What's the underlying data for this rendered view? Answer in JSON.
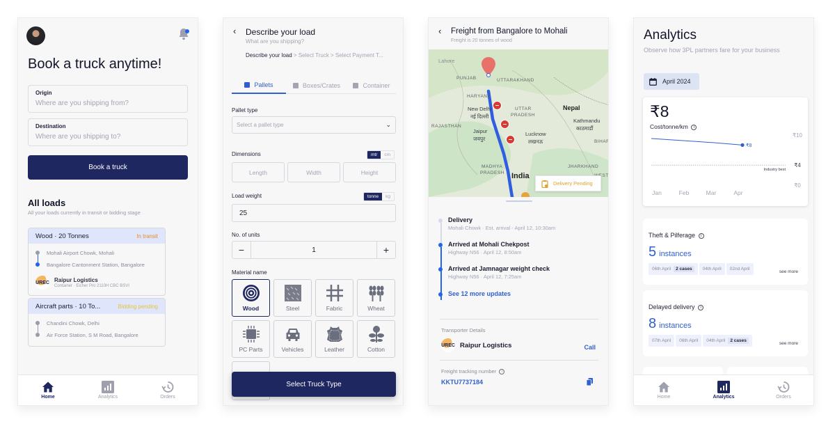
{
  "screen_home": {
    "title": "Book a truck anytime!",
    "origin": {
      "label": "Origin",
      "placeholder": "Where are you shipping from?"
    },
    "destination": {
      "label": "Destination",
      "placeholder": "Where are you shipping to?"
    },
    "book_button": "Book a truck",
    "all_loads_title": "All loads",
    "all_loads_subtitle": "All your loads currently in transit or bidding stage",
    "loads": [
      {
        "title": "Wood · 20 Tonnes",
        "status": "In transit",
        "status_color": "#e88a2e",
        "from": "Mohali Airport Chowk, Mohali",
        "to": "Bangalore Cantonment Station, Bangalore",
        "transporter": "Raipur Logistics",
        "vehicle": "Container · Eicher Pro 2110H CBC BSVI"
      },
      {
        "title": "Aircraft parts · 10 To...",
        "status": "Bidding pending",
        "status_color": "#e8c23a",
        "from": "Chandini Chowk, Delhi",
        "to": "Air Force Station, S M Road, Bangalore"
      }
    ],
    "nav": [
      {
        "label": "Home",
        "icon": "home-icon",
        "active": true
      },
      {
        "label": "Analytics",
        "icon": "analytics-icon",
        "active": false
      },
      {
        "label": "Orders",
        "icon": "history-icon",
        "active": false
      }
    ]
  },
  "screen_describe": {
    "title": "Describe your load",
    "subtitle": "What are you shipping?",
    "breadcrumb": {
      "current": "Describe your load",
      "rest": " > Select Truck > Select Payment T..."
    },
    "tabs": [
      {
        "label": "Pallets",
        "active": true
      },
      {
        "label": "Boxes/Crates",
        "active": false
      },
      {
        "label": "Container",
        "active": false
      }
    ],
    "pallet_type": {
      "label": "Pallet type",
      "placeholder": "Select a pallet type"
    },
    "dimensions": {
      "label": "Dimensions",
      "units": [
        "mtr",
        "cm"
      ],
      "selected_unit": "mtr",
      "fields": [
        "Length",
        "Width",
        "Height"
      ]
    },
    "load_weight": {
      "label": "Load weight",
      "units": [
        "tonne",
        "kg"
      ],
      "selected_unit": "tonne",
      "value": "25"
    },
    "units": {
      "label": "No. of units",
      "value": "1",
      "minus": "−",
      "plus": "+"
    },
    "material": {
      "label": "Material name",
      "selected": "Wood",
      "items": [
        "Wood",
        "Steel",
        "Fabric",
        "Wheat",
        "PC Parts",
        "Vehicles",
        "Leather",
        "Cotton"
      ]
    },
    "cta": "Select Truck Type"
  },
  "screen_freight": {
    "title": "Freight from Bangalore to Mohali",
    "subtitle": "Freight is 20 tonnes of wood",
    "map_labels": {
      "lahore": "Lahore",
      "punjab": "PUNJAB",
      "uttarakhand": "UTTARAKHAND",
      "haryana": "HARYANA",
      "new_delhi": "New Delhi",
      "new_delhi_hi": "नई दिल्ली",
      "uttar": "UTTAR",
      "pradesh": "PRADESH",
      "nepal": "Nepal",
      "kathmandu": "Kathmandu",
      "kathmandu_hi": "काठमाडौं",
      "rajasthan": "RAJASTHAN",
      "jaipur": "Jaipur",
      "jaipur_hi": "जयपुर",
      "lucknow": "Lucknow",
      "lucknow_hi": "लखनऊ",
      "bihar": "BIHAR",
      "madhya": "MADHYA",
      "madhya_pradesh": "PRADESH",
      "jharkhand": "JHARKHAND",
      "india": "India",
      "west": "WEST"
    },
    "delivery_status": "Delivery Pending",
    "timeline": [
      {
        "title": "Delivery",
        "sub": "Mohali Chowk  ·  Est. arrival - April 12, 10:30am",
        "done": false
      },
      {
        "title": "Arrived at Mohali Chekpost",
        "sub": "Highway N56  ·  April 12, 8:50am",
        "done": true
      },
      {
        "title": "Arrived at Jamnagar weight check",
        "sub": "Highway N56  ·  April 12, 7:25am",
        "done": true
      }
    ],
    "more_updates": "See 12 more updates",
    "transporter_label": "Transporter Details",
    "transporter_name": "Raipur Logistics",
    "call": "Call",
    "tracking_label": "Freight tracking number",
    "tracking_number": "KKTU7737184"
  },
  "screen_analytics": {
    "title": "Analytics",
    "subtitle": "Observe how 3PL partners fare for your business",
    "date": "April 2024",
    "cost": {
      "value": "₹8",
      "label": "Cost/tonne/km",
      "point_label": "₹8",
      "industry_best": "Industry best"
    },
    "chart_data": {
      "type": "line",
      "title": "Cost/tonne/km",
      "categories": [
        "Jan",
        "Feb",
        "Mar",
        "Apr"
      ],
      "series": [
        {
          "name": "Cost/tonne/km",
          "values": [
            9.3,
            8.9,
            8.5,
            8.0
          ]
        }
      ],
      "reference_line": {
        "label": "Industry best",
        "value": 4
      },
      "y_ticks": [
        "₹10",
        "₹4",
        "₹0"
      ],
      "ylim": [
        0,
        10
      ],
      "grid": false
    },
    "theft": {
      "title": "Theft & Pilferage",
      "count": "5",
      "unit": "instances",
      "chips": [
        {
          "date": "06th April",
          "badge": "2 cases"
        },
        {
          "date": "04th April",
          "badge": ""
        },
        {
          "date": "02nd April",
          "badge": ""
        }
      ],
      "see_more": "see more"
    },
    "delayed": {
      "title": "Delayed delivery",
      "count": "8",
      "unit": "instances",
      "chips": [
        {
          "date": "07th April",
          "badge": ""
        },
        {
          "date": "06th April",
          "badge": ""
        },
        {
          "date": "04th April",
          "badge": "2 cases"
        }
      ],
      "see_more": "see more"
    },
    "nav": [
      {
        "label": "Home",
        "active": false
      },
      {
        "label": "Analytics",
        "active": true
      },
      {
        "label": "Orders",
        "active": false
      }
    ]
  }
}
